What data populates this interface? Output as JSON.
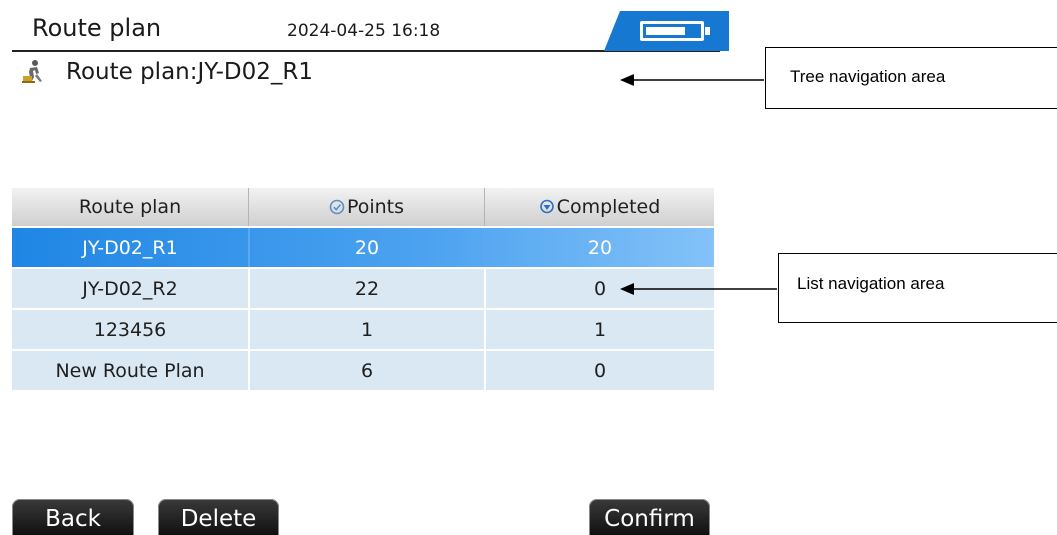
{
  "header": {
    "title": "Route plan",
    "datetime": "2024-04-25 16:18",
    "battery_level": 0.75,
    "accent_color": "#1778d2"
  },
  "tree": {
    "icon": "route-plan-icon",
    "text": "Route plan:JY-D02_R1"
  },
  "table": {
    "columns": [
      {
        "label": "Route plan",
        "icon": null
      },
      {
        "label": "Points",
        "icon": "checkmark-circle-icon"
      },
      {
        "label": "Completed",
        "icon": "location-pin-icon"
      }
    ],
    "rows": [
      {
        "name": "JY-D02_R1",
        "points": "20",
        "completed": "20",
        "selected": true
      },
      {
        "name": "JY-D02_R2",
        "points": "22",
        "completed": "0",
        "selected": false
      },
      {
        "name": "123456",
        "points": "1",
        "completed": "1",
        "selected": false
      },
      {
        "name": "New Route Plan",
        "points": "6",
        "completed": "0",
        "selected": false
      }
    ],
    "selected_color": "#1f86e4",
    "row_color": "#d9e8f3"
  },
  "buttons": {
    "back": "Back",
    "delete": "Delete",
    "confirm": "Confirm"
  },
  "callouts": {
    "tree": "Tree navigation area",
    "list": "List navigation area"
  }
}
